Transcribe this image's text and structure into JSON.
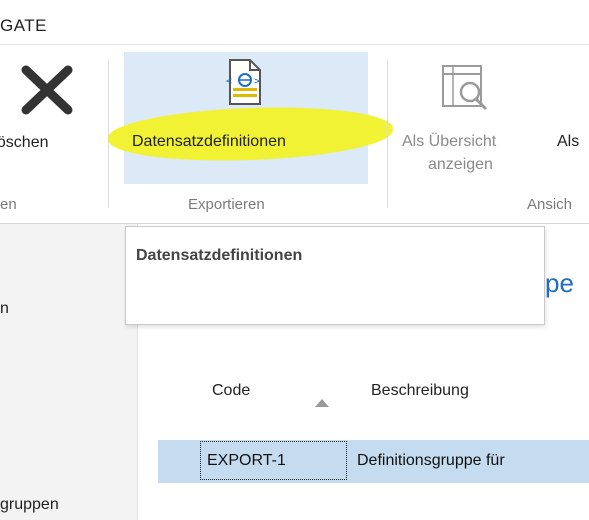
{
  "window": {
    "title": "GATE"
  },
  "ribbon": {
    "delete_label": "Löschen",
    "datensatz_label": "Datensatzdefinitionen",
    "overview_line1": "Als Übersicht",
    "overview_line2": "anzeigen",
    "als_label": "Als",
    "group_left": "en",
    "group_export": "Exportieren",
    "group_view": "Ansich"
  },
  "tooltip": {
    "title": "Datensatzdefinitionen"
  },
  "page": {
    "title_fragment": "pe"
  },
  "nav": {
    "item_top": "n",
    "item_bottom": "gruppen"
  },
  "table": {
    "headers": [
      "Code",
      "Beschreibung"
    ],
    "rows": [
      {
        "code": "EXPORT-1",
        "description": "Definitionsgruppe für"
      }
    ]
  },
  "colors": {
    "highlight": "#f2f22a",
    "selected_button": "#dce9f6",
    "selected_row": "#c5dcf0",
    "link_blue": "#1f6fc5"
  }
}
